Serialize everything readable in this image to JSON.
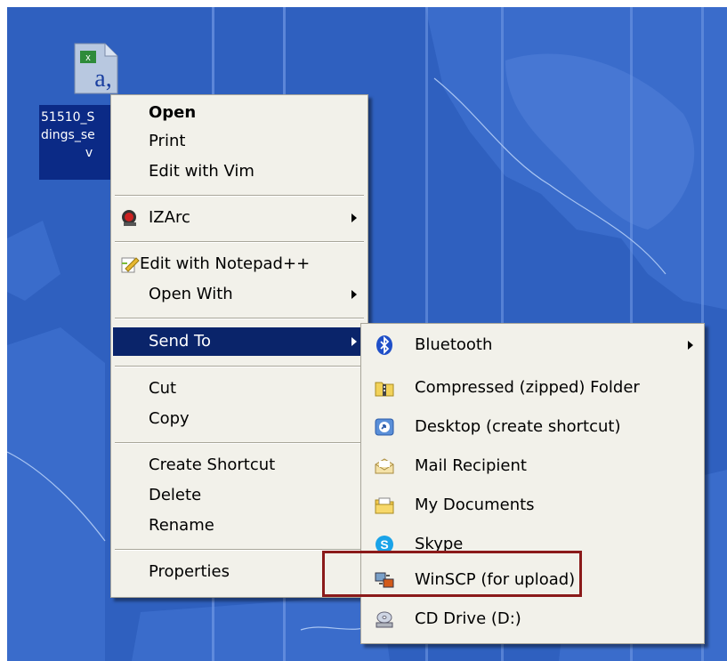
{
  "desktop_file": {
    "label_lines": [
      "51510_S",
      "dings_se",
      "v"
    ]
  },
  "context_menu": {
    "items": [
      {
        "label": "Open",
        "bold": true
      },
      {
        "label": "Print"
      },
      {
        "label": "Edit with Vim"
      },
      {
        "label": "IZArc",
        "submenu": true,
        "icon": "izarc-icon"
      },
      {
        "label": "Edit with Notepad++",
        "icon": "notepadpp-icon"
      },
      {
        "label": "Open With",
        "submenu": true
      },
      {
        "label": "Send To",
        "submenu": true,
        "highlighted": true
      },
      {
        "label": "Cut"
      },
      {
        "label": "Copy"
      },
      {
        "label": "Create Shortcut"
      },
      {
        "label": "Delete"
      },
      {
        "label": "Rename"
      },
      {
        "label": "Properties"
      }
    ]
  },
  "send_to_menu": {
    "items": [
      {
        "label": "Bluetooth",
        "submenu": true,
        "icon": "bluetooth-icon"
      },
      {
        "label": "Compressed (zipped) Folder",
        "icon": "zip-folder-icon"
      },
      {
        "label": "Desktop (create shortcut)",
        "icon": "desktop-shortcut-icon"
      },
      {
        "label": "Mail Recipient",
        "icon": "mail-icon"
      },
      {
        "label": "My Documents",
        "icon": "my-documents-icon"
      },
      {
        "label": "Skype",
        "icon": "skype-icon"
      },
      {
        "label": "WinSCP (for upload)",
        "icon": "winscp-icon"
      },
      {
        "label": "CD Drive (D:)",
        "icon": "cd-drive-icon"
      }
    ]
  },
  "colors": {
    "desktop_bg": "#2e5fbe",
    "menu_bg": "#f2f1ea",
    "highlight_bg": "#0a246a",
    "annotation_box": "#8b1a1a"
  }
}
